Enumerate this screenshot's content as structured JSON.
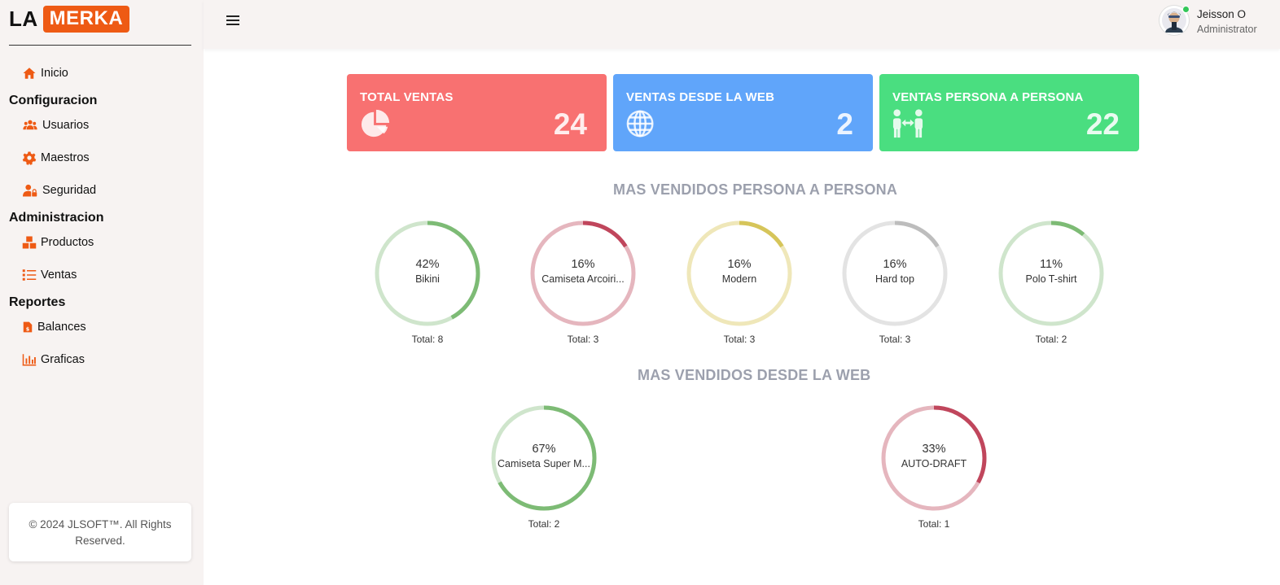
{
  "brand": {
    "part1": "LA",
    "part2": "MERKA"
  },
  "sidebar": {
    "inicio": "Inicio",
    "sections": [
      {
        "title": "Configuracion",
        "items": [
          "Usuarios",
          "Maestros",
          "Seguridad"
        ]
      },
      {
        "title": "Administracion",
        "items": [
          "Productos",
          "Ventas"
        ]
      },
      {
        "title": "Reportes",
        "items": [
          "Balances",
          "Graficas"
        ]
      }
    ],
    "footer": "© 2024 JLSOFT™. All Rights Reserved."
  },
  "user": {
    "name": "Jeisson O",
    "role": "Administrator"
  },
  "cards": [
    {
      "title": "TOTAL VENTAS",
      "value": "24",
      "icon": "pie-chart-icon",
      "color": "#f87171"
    },
    {
      "title": "VENTAS DESDE LA WEB",
      "value": "2",
      "icon": "globe-icon",
      "color": "#60a5fa"
    },
    {
      "title": "VENTAS PERSONA A PERSONA",
      "value": "22",
      "icon": "people-exchange-icon",
      "color": "#4ade80"
    }
  ],
  "sections": {
    "persona": "MAS VENDIDOS PERSONA A PERSONA",
    "web": "MAS VENDIDOS DESDE LA WEB"
  },
  "persona_donuts": [
    {
      "pct": "42%",
      "name": "Bikini",
      "total": "Total: 8",
      "fraction": 0.42,
      "color": "#7dbb75",
      "track": "#cfe5cc"
    },
    {
      "pct": "16%",
      "name": "Camiseta Arcoiri...",
      "total": "Total: 3",
      "fraction": 0.16,
      "color": "#c0465c",
      "track": "#e5b6be"
    },
    {
      "pct": "16%",
      "name": "Modern",
      "total": "Total: 3",
      "fraction": 0.16,
      "color": "#d6c55a",
      "track": "#efe7b9"
    },
    {
      "pct": "16%",
      "name": "Hard top",
      "total": "Total: 3",
      "fraction": 0.16,
      "color": "#bdbdbd",
      "track": "#e3e3e3"
    },
    {
      "pct": "11%",
      "name": "Polo T-shirt",
      "total": "Total: 2",
      "fraction": 0.11,
      "color": "#7dbb75",
      "track": "#cfe5cc"
    }
  ],
  "web_donuts": [
    {
      "pct": "67%",
      "name": "Camiseta Super M...",
      "total": "Total: 2",
      "fraction": 0.67,
      "color": "#7dbb75",
      "track": "#cfe5cc"
    },
    {
      "pct": "33%",
      "name": "AUTO-DRAFT",
      "total": "Total: 1",
      "fraction": 0.33,
      "color": "#c0465c",
      "track": "#e5b6be"
    }
  ]
}
